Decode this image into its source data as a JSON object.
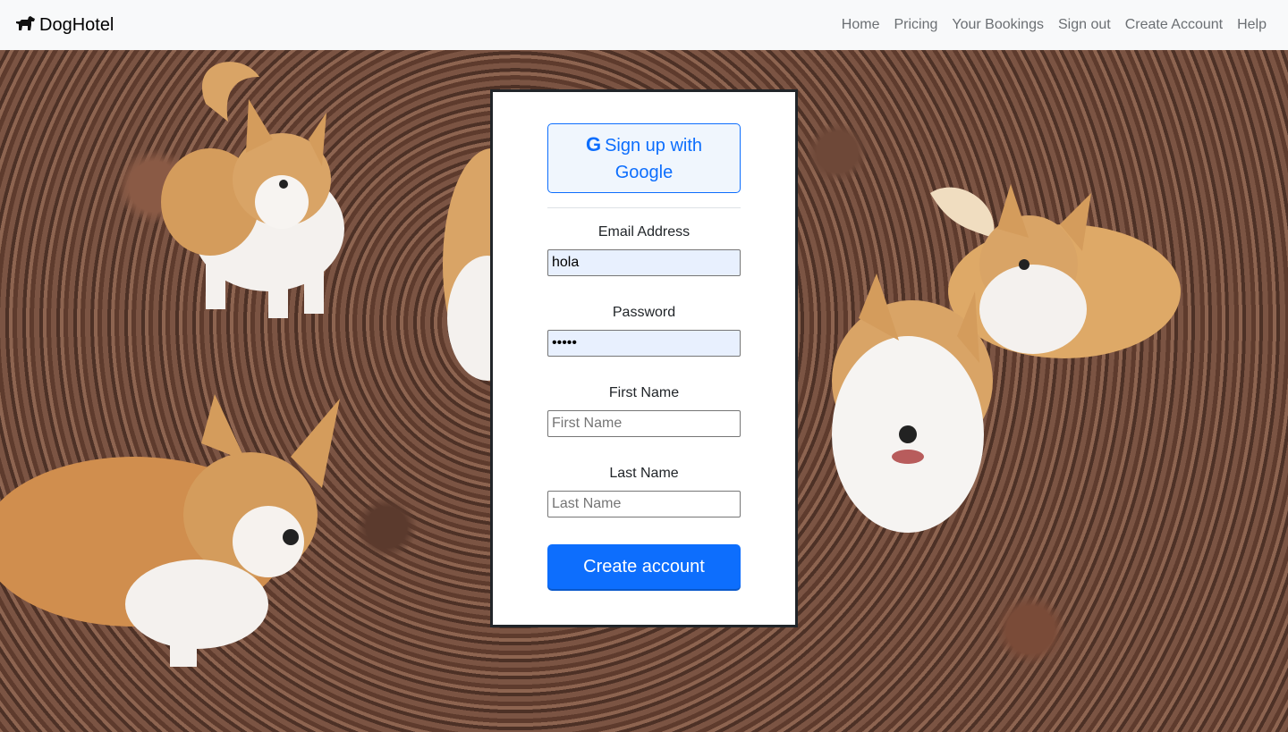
{
  "navbar": {
    "brand": "DogHotel",
    "links": [
      {
        "label": "Home"
      },
      {
        "label": "Pricing"
      },
      {
        "label": "Your Bookings"
      },
      {
        "label": "Sign out"
      },
      {
        "label": "Create Account"
      },
      {
        "label": "Help"
      }
    ]
  },
  "form": {
    "google_button": "Sign up with Google",
    "google_icon": "google-g-icon",
    "email": {
      "label": "Email Address",
      "value": "hola"
    },
    "password": {
      "label": "Password",
      "value": "hello"
    },
    "first_name": {
      "label": "First Name",
      "placeholder": "First Name",
      "value": ""
    },
    "last_name": {
      "label": "Last Name",
      "placeholder": "Last Name",
      "value": ""
    },
    "submit": "Create account"
  },
  "colors": {
    "accent": "#0d6efd",
    "navbar_bg": "#f8f9fa",
    "autofill_bg": "#e8f0fe"
  }
}
